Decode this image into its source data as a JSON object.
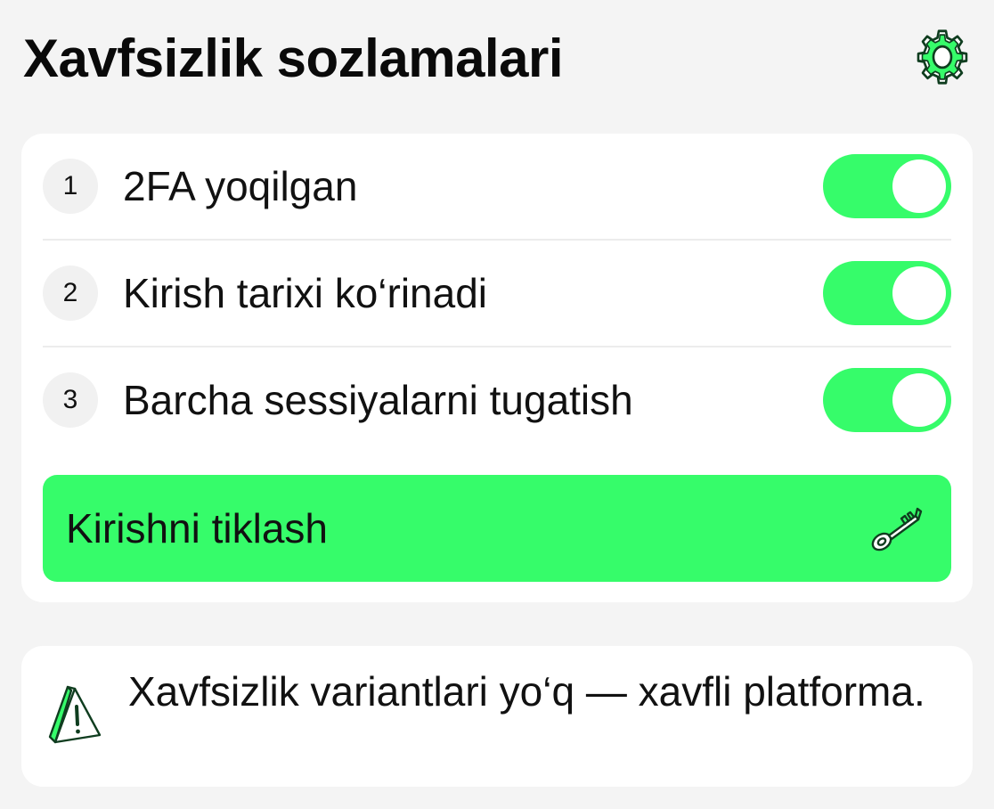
{
  "header": {
    "title": "Xavfsizlik sozlamalari",
    "settings_icon": "gear-icon"
  },
  "settings": {
    "items": [
      {
        "number": "1",
        "label": "2FA yoqilgan",
        "enabled": true
      },
      {
        "number": "2",
        "label": "Kirish tarixi ko‘rinadi",
        "enabled": true
      },
      {
        "number": "3",
        "label": "Barcha sessiyalarni tugatish",
        "enabled": true
      }
    ],
    "action": {
      "label": "Kirishni tiklash",
      "icon": "key-icon"
    }
  },
  "warning": {
    "icon": "warning-icon",
    "text": "Xavfsizlik variantlari yo‘q — xavfli platforma."
  },
  "colors": {
    "accent": "#36fc6a",
    "background": "#f4f4f4",
    "card": "#ffffff",
    "icon_stroke": "#0f3d1f"
  }
}
